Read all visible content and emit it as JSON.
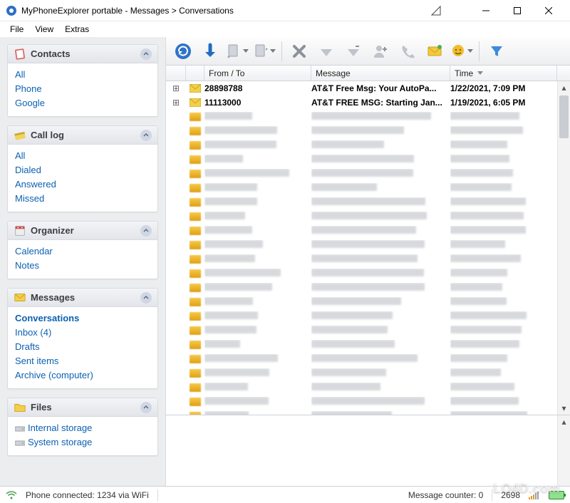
{
  "window": {
    "title": "MyPhoneExplorer portable -  Messages > Conversations"
  },
  "menus": [
    "File",
    "View",
    "Extras"
  ],
  "sidebar": {
    "sections": [
      {
        "title": "Contacts",
        "icon": "contacts-icon",
        "items": [
          {
            "label": "All"
          },
          {
            "label": "Phone"
          },
          {
            "label": "Google"
          }
        ]
      },
      {
        "title": "Call log",
        "icon": "calllog-icon",
        "items": [
          {
            "label": "All"
          },
          {
            "label": "Dialed"
          },
          {
            "label": "Answered"
          },
          {
            "label": "Missed"
          }
        ]
      },
      {
        "title": "Organizer",
        "icon": "organizer-icon",
        "items": [
          {
            "label": "Calendar"
          },
          {
            "label": "Notes"
          }
        ]
      },
      {
        "title": "Messages",
        "icon": "messages-icon",
        "items": [
          {
            "label": "Conversations",
            "active": true
          },
          {
            "label": "Inbox (4)"
          },
          {
            "label": "Drafts"
          },
          {
            "label": "Sent items"
          },
          {
            "label": "Archive (computer)"
          }
        ]
      },
      {
        "title": "Files",
        "icon": "files-icon",
        "items": [
          {
            "label": "Internal storage",
            "icon": "drive"
          },
          {
            "label": "System storage",
            "icon": "drive"
          }
        ]
      }
    ]
  },
  "columns": {
    "from": "From / To",
    "message": "Message",
    "time": "Time"
  },
  "rows_visible": [
    {
      "expand": true,
      "from": "28898788",
      "message": "AT&T Free Msg: Your AutoPa...",
      "time": "1/22/2021, 7:09 PM"
    },
    {
      "expand": true,
      "from": "11113000",
      "message": "AT&T FREE MSG: Starting Jan...",
      "time": "1/19/2021, 6:05 PM"
    }
  ],
  "blurred_row_count": 22,
  "status": {
    "connection": "Phone connected: 1234 via WiFi",
    "counter_label": "Message counter: 0",
    "count2": "2698"
  },
  "watermark": "LO4D.com"
}
